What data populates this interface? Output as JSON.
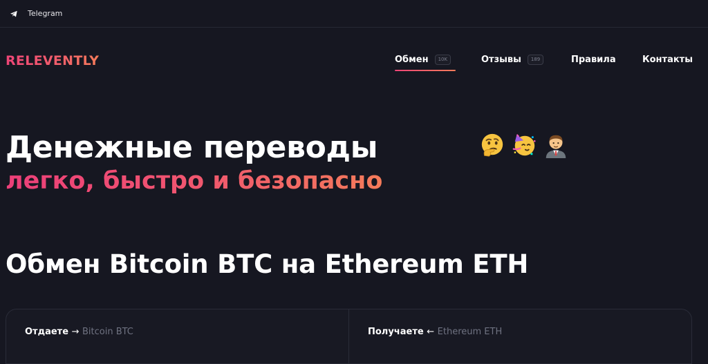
{
  "topbar": {
    "telegram_label": "Telegram"
  },
  "header": {
    "logo": "RELEVENTLY",
    "nav": [
      {
        "label": "Обмен",
        "badge": "10K",
        "active": true
      },
      {
        "label": "Отзывы",
        "badge": "189",
        "active": false
      },
      {
        "label": "Правила",
        "badge": null,
        "active": false
      },
      {
        "label": "Контакты",
        "badge": null,
        "active": false
      }
    ]
  },
  "hero": {
    "title": "Денежные переводы",
    "subtitle": "легко, быстро и безопасно",
    "emojis": [
      "thinking-face-icon",
      "partying-face-icon",
      "man-office-worker-icon"
    ]
  },
  "exchange": {
    "title": "Обмен Bitcoin BTC на Ethereum ETH",
    "give_label": "Отдаете",
    "give_arrow": "→",
    "give_currency": "Bitcoin BTC",
    "get_label": "Получаете",
    "get_arrow": "←",
    "get_currency": "Ethereum ETH"
  },
  "colors": {
    "background": "#161721",
    "accent_start": "#ee4577",
    "accent_end": "#f47b5a",
    "muted_text": "#6f7281"
  }
}
